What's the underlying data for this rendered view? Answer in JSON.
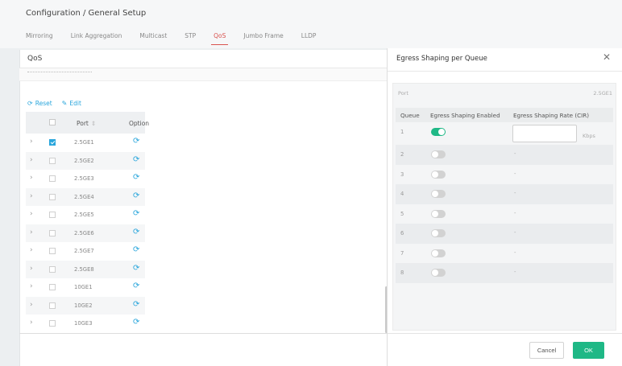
{
  "header": {
    "breadcrumb": "Configuration / General Setup",
    "tabs": [
      {
        "label": "Mirroring",
        "active": false
      },
      {
        "label": "Link Aggregation",
        "active": false
      },
      {
        "label": "Multicast",
        "active": false
      },
      {
        "label": "STP",
        "active": false
      },
      {
        "label": "QoS",
        "active": true
      },
      {
        "label": "Jumbo Frame",
        "active": false
      },
      {
        "label": "LLDP",
        "active": false
      }
    ]
  },
  "qos_panel": {
    "title": "QoS",
    "actions": {
      "reset": "Reset",
      "edit": "Edit"
    },
    "columns": {
      "port": "Port",
      "option": "Option"
    },
    "rows": [
      {
        "port": "2.5GE1",
        "checked": true
      },
      {
        "port": "2.5GE2",
        "checked": false
      },
      {
        "port": "2.5GE3",
        "checked": false
      },
      {
        "port": "2.5GE4",
        "checked": false
      },
      {
        "port": "2.5GE5",
        "checked": false
      },
      {
        "port": "2.5GE6",
        "checked": false
      },
      {
        "port": "2.5GE7",
        "checked": false
      },
      {
        "port": "2.5GE8",
        "checked": false
      },
      {
        "port": "10GE1",
        "checked": false
      },
      {
        "port": "10GE2",
        "checked": false
      },
      {
        "port": "10GE3",
        "checked": false
      }
    ]
  },
  "modal": {
    "title": "Egress Shaping per Queue",
    "port_label": "Port",
    "port_value": "2.5GE1",
    "columns": {
      "queue": "Queue",
      "enabled": "Egress Shaping Enabled",
      "rate": "Egress Shaping Rate (CIR)"
    },
    "queues": [
      {
        "queue": "1",
        "enabled": true,
        "rate": ""
      },
      {
        "queue": "2",
        "enabled": false,
        "rate": "-"
      },
      {
        "queue": "3",
        "enabled": false,
        "rate": "-"
      },
      {
        "queue": "4",
        "enabled": false,
        "rate": "-"
      },
      {
        "queue": "5",
        "enabled": false,
        "rate": "-"
      },
      {
        "queue": "6",
        "enabled": false,
        "rate": "-"
      },
      {
        "queue": "7",
        "enabled": false,
        "rate": "-"
      },
      {
        "queue": "8",
        "enabled": false,
        "rate": "-"
      }
    ],
    "rate_unit": "Kbps",
    "cancel_label": "Cancel",
    "ok_label": "OK"
  },
  "colors": {
    "accent": "#2aa6dc",
    "active_tab": "#d9534f",
    "toggle_on": "#1fb886",
    "ok_button": "#1fb886"
  }
}
